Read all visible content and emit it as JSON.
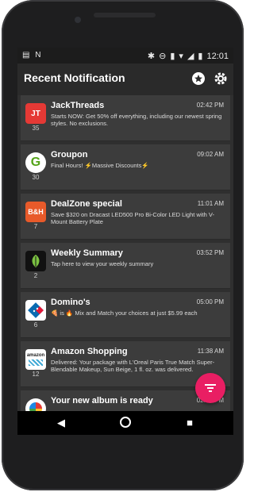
{
  "statusbar": {
    "left_icons": "▤ N",
    "time": "12:01"
  },
  "appbar": {
    "title": "Recent Notification"
  },
  "notifications": [
    {
      "app": "JackThreads",
      "time": "02:42 PM",
      "count": "35",
      "message": "Starts NOW: Get 50% off everything, including our newest spring styles. No exclusions.",
      "logo_text": "JT",
      "logo_bg": "#e53935",
      "logo_fg": "#ffffff"
    },
    {
      "app": "Groupon",
      "time": "09:02 AM",
      "count": "30",
      "message": "Final Hours! ⚡Massive Discounts⚡",
      "logo_text": "G",
      "logo_bg": "#ffffff",
      "logo_fg": "#53a318"
    },
    {
      "app": "DealZone special",
      "time": "11:01 AM",
      "count": "7",
      "message": "Save $320 on Dracast LED500 Pro Bi-Color LED Light with V-Mount Battery Plate",
      "logo_text": "B&H",
      "logo_bg": "#e85a2a",
      "logo_fg": "#ffffff"
    },
    {
      "app": "Weekly Summary",
      "time": "03:52 PM",
      "count": "2",
      "message": "Tap here to view your weekly summary",
      "logo_text": "",
      "logo_bg": "#111111",
      "logo_fg": "#7cc242"
    },
    {
      "app": "Domino's",
      "time": "05:00 PM",
      "count": "6",
      "message": "🍕 is 🔥 Mix and Match your choices at just $5.99 each",
      "logo_text": "",
      "logo_bg": "#ffffff",
      "logo_fg": "#0b6bb1"
    },
    {
      "app": "Amazon Shopping",
      "time": "11:38 AM",
      "count": "12",
      "message": "Delivered: Your package with L'Oreal Paris True Match Super-Blendable Makeup, Sun Beige, 1 fl. oz. was delivered.",
      "logo_text": "amazon",
      "logo_bg": "#ffffff",
      "logo_fg": "#222222"
    },
    {
      "app": "Your new album is ready",
      "time": "02:28 PM",
      "count": "",
      "message": "",
      "logo_text": "",
      "logo_bg": "#ffffff",
      "logo_fg": "#e53935"
    }
  ],
  "colors": {
    "fab": "#e91e63",
    "card": "#3c3c3c",
    "screen": "#2f2f2f"
  },
  "icons": {
    "star": "star-icon",
    "settings": "gear-icon",
    "fab": "filter-icon"
  }
}
